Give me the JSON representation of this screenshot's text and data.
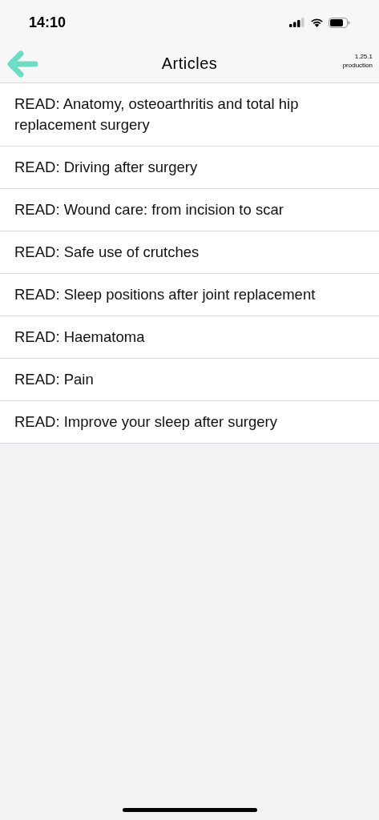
{
  "status_bar": {
    "time": "14:10"
  },
  "nav_bar": {
    "title": "Articles",
    "version": "1.25.1",
    "environment": "production"
  },
  "articles": [
    {
      "title": "READ: Anatomy, osteoarthritis and total hip replacement surgery"
    },
    {
      "title": "READ: Driving after surgery"
    },
    {
      "title": "READ: Wound care: from incision to scar"
    },
    {
      "title": "READ: Safe use of crutches"
    },
    {
      "title": "READ: Sleep positions after joint replacement"
    },
    {
      "title": "READ: Haematoma"
    },
    {
      "title": "READ: Pain"
    },
    {
      "title": "READ: Improve your sleep after surgery"
    }
  ]
}
